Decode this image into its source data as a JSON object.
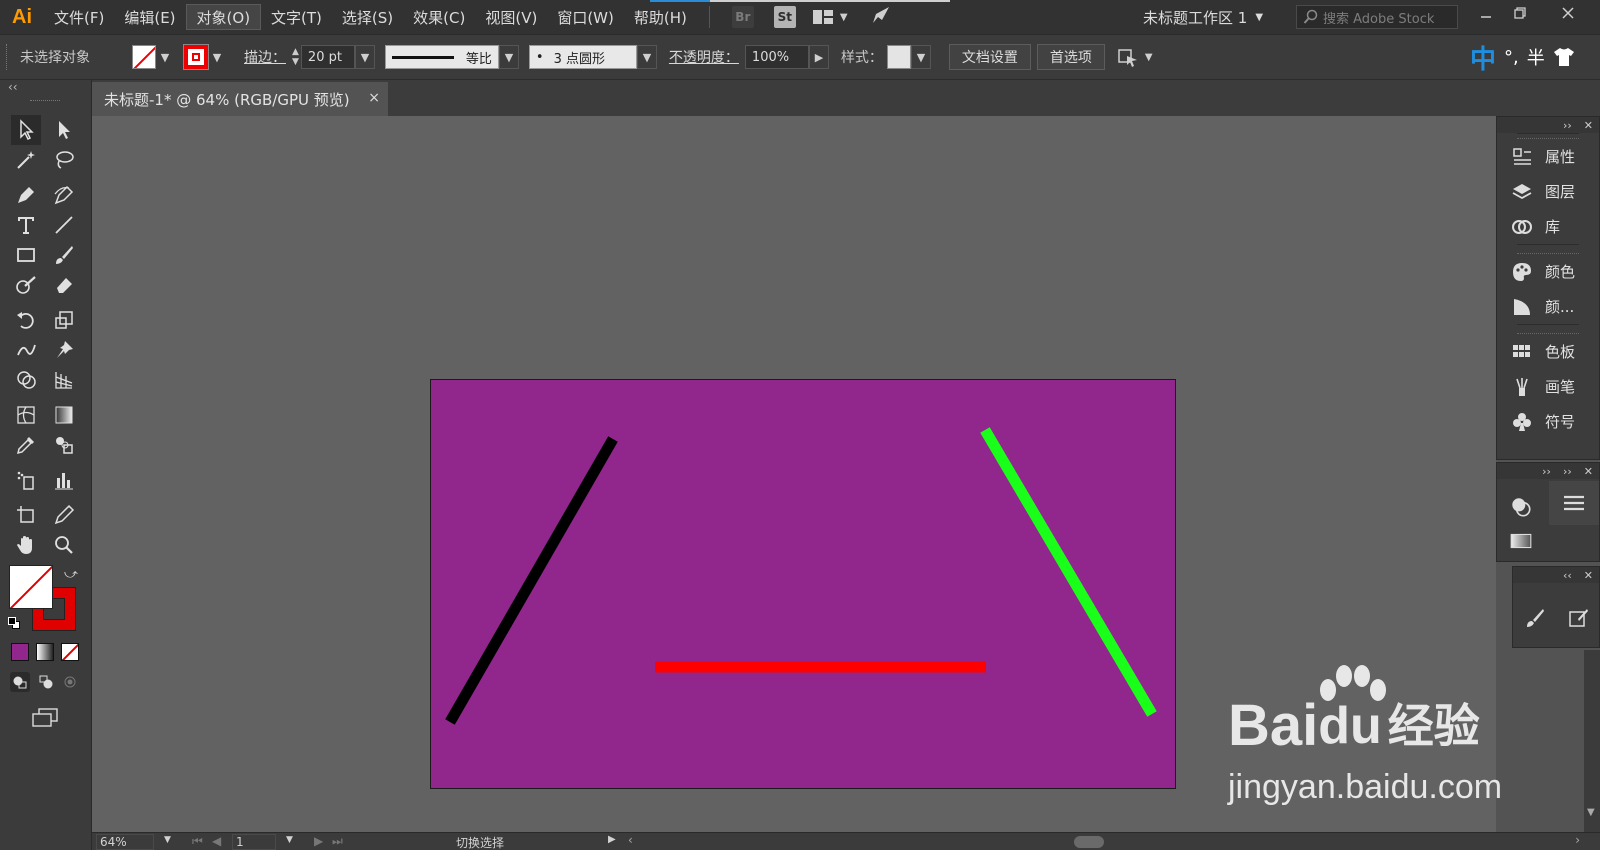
{
  "app": {
    "logo": "Ai"
  },
  "menu": [
    "文件(F)",
    "编辑(E)",
    "对象(O)",
    "文字(T)",
    "选择(S)",
    "效果(C)",
    "视图(V)",
    "窗口(W)",
    "帮助(H)"
  ],
  "menu_active_index": 2,
  "apps": {
    "bridge": "Br",
    "stock": "St"
  },
  "workspace": "未标题工作区 1",
  "search_placeholder": "搜索 Adobe Stock",
  "control": {
    "selection_label": "未选择对象",
    "stroke_label": "描边：",
    "stroke_weight": "20 pt",
    "profile_label": "等比",
    "brush_label": "3 点圆形",
    "brush_dot": "•",
    "opacity_label": "不透明度：",
    "opacity_value": "100%",
    "style_label": "样式：",
    "doc_setup": "文档设置",
    "preferences": "首选项"
  },
  "ime": {
    "lang": "中",
    "punct": "°,",
    "width": "半"
  },
  "document_tab": {
    "title": "未标题-1* @ 64% (RGB/GPU 预览)",
    "close": "×"
  },
  "panels": {
    "group1": [
      "属性",
      "图层",
      "库"
    ],
    "group2": [
      "颜色",
      "颜..."
    ],
    "group3": [
      "色板",
      "画笔",
      "符号"
    ]
  },
  "status": {
    "zoom": "64%",
    "artboard_num": "1",
    "tool_hint": "切换选择"
  },
  "watermark": {
    "brand": "Bai",
    "brand2": "du",
    "suffix": "经验",
    "url": "jingyan.baidu.com"
  },
  "colors": {
    "artboard_fill": "#91268c",
    "line_black": "#000000",
    "line_red": "#ff0000",
    "line_green": "#1aff1a",
    "stroke_red": "#e00000",
    "logo_orange": "#ff9a00"
  }
}
